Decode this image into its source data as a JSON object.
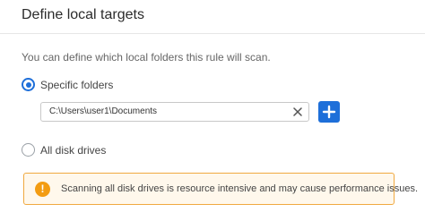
{
  "dialog": {
    "title": "Define local targets",
    "description": "You can define which local folders this rule will scan."
  },
  "options": {
    "specific": {
      "label": "Specific folders",
      "selected": true
    },
    "all": {
      "label": "All disk drives",
      "selected": false
    }
  },
  "folder_input": {
    "value": "C:\\Users\\user1\\Documents"
  },
  "warning": {
    "icon_text": "!",
    "text": "Scanning all disk drives is resource intensive and may cause performance issues."
  },
  "colors": {
    "accent": "#1e6fd9",
    "warning": "#f39c12",
    "warning_border": "#f0a940",
    "warning_bg": "#fff8ec"
  },
  "icons": {
    "clear": "close-icon",
    "add": "plus-icon",
    "warning": "warning-icon"
  }
}
